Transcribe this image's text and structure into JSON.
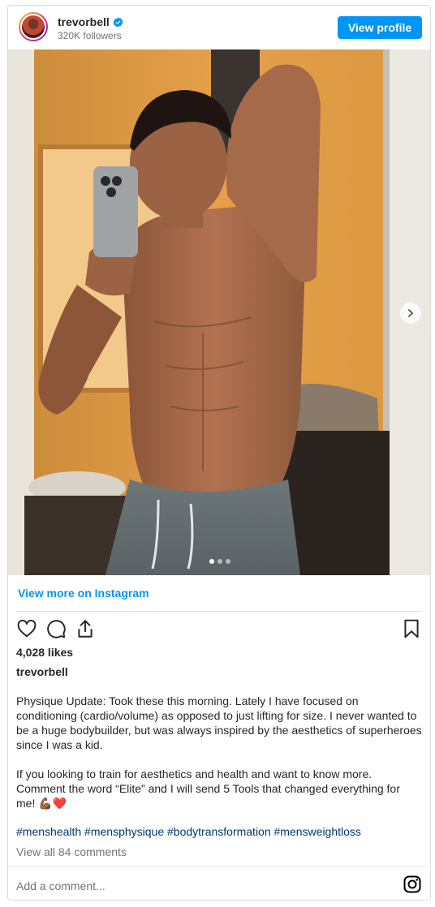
{
  "header": {
    "username": "trevorbell",
    "followers": "320K followers",
    "view_profile_label": "View profile"
  },
  "photo": {
    "alt": "Mirror selfie of shirtless man in grey sweatpants",
    "carousel_count": 3,
    "carousel_active": 1
  },
  "links": {
    "view_more": "View more on Instagram"
  },
  "actions": {
    "icons": [
      "heart-icon",
      "comment-icon",
      "share-icon",
      "bookmark-icon"
    ]
  },
  "stats": {
    "likes": "4,028 likes"
  },
  "caption": {
    "username": "trevorbell",
    "paragraph1": "Physique Update: Took these this morning. Lately I have focused on conditioning (cardio/volume) as opposed to just lifting for size. I never wanted to be a huge bodybuilder, but was always inspired by the aesthetics of superheroes since I was a kid.",
    "paragraph2": "If you looking to train for aesthetics and health and want to know more. Comment the word “Elite” and I will send 5 Tools that changed everything for me! 💪🏾❤️",
    "hashtags": "#menshealth #mensphysique #bodytransformation #mensweightloss"
  },
  "comments": {
    "view_all": "View all 84 comments",
    "add_placeholder": "Add a comment..."
  },
  "colors": {
    "accent": "#0095f6",
    "hashtag": "#00376b",
    "muted": "#737373",
    "border": "#dbdbdb"
  }
}
